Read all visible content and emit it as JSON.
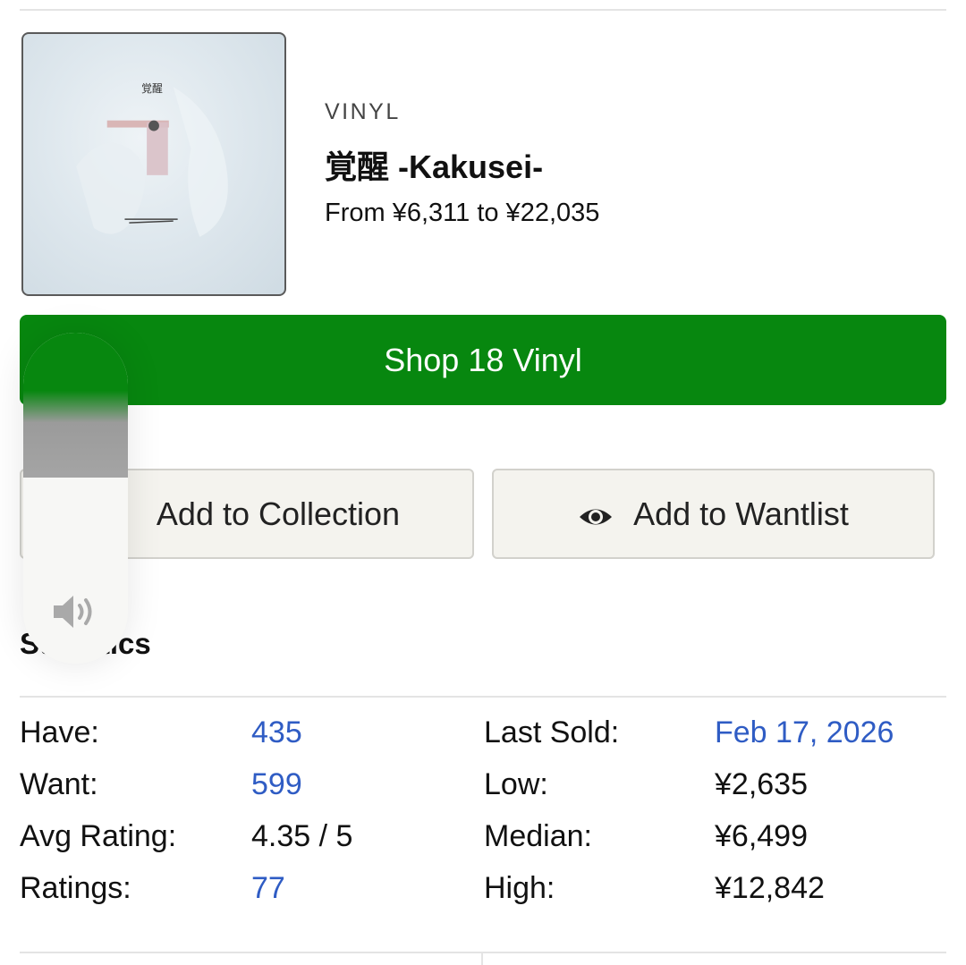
{
  "release": {
    "format": "VINYL",
    "title": "覚醒 -Kakusei-",
    "price_range": "From ¥6,311 to ¥22,035"
  },
  "actions": {
    "shop_label": "Shop 18 Vinyl",
    "collection_label": "Add to Collection",
    "wantlist_label": "Add to Wantlist"
  },
  "statistics": {
    "heading": "Statistics",
    "left": [
      {
        "label": "Have:",
        "value": "435"
      },
      {
        "label": "Want:",
        "value": "599"
      },
      {
        "label": "Avg Rating:",
        "value": "4.35 / 5"
      },
      {
        "label": "Ratings:",
        "value": "77"
      }
    ],
    "right": [
      {
        "label": "Last Sold:",
        "value": "Feb 17, 2026"
      },
      {
        "label": "Low:",
        "value": "¥2,635"
      },
      {
        "label": "Median:",
        "value": "¥6,499"
      },
      {
        "label": "High:",
        "value": "¥12,842"
      }
    ]
  },
  "volume_hud": {
    "icon": "speaker-icon",
    "level": 0.44
  },
  "colors": {
    "shop_green": "#07870f",
    "link_blue": "#2f5cc4",
    "button_bg": "#f4f3ee"
  }
}
